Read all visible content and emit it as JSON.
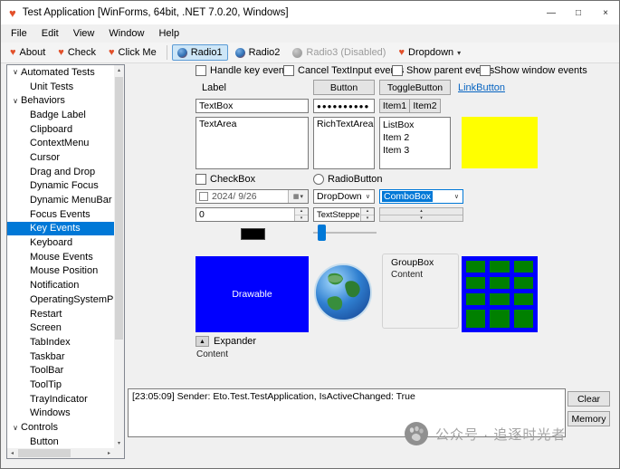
{
  "window": {
    "title": "Test Application [WinForms, 64bit, .NET 7.0.20, Windows]",
    "minimize": "—",
    "maximize": "□",
    "close": "×"
  },
  "menu": {
    "items": [
      "File",
      "Edit",
      "View",
      "Window",
      "Help"
    ]
  },
  "toolbar": {
    "about": "About",
    "check": "Check",
    "click_me": "Click Me",
    "radio1": "Radio1",
    "radio2": "Radio2",
    "radio3": "Radio3 (Disabled)",
    "dropdown": "Dropdown"
  },
  "icons": {
    "heart": "♥",
    "tree_expanded": "∨",
    "caret_up": "▴",
    "caret_down": "▾",
    "arrow_left": "◂",
    "arrow_right": "▸",
    "select_arrow": "∨",
    "calendar": "▦",
    "expander_collapse": "▲"
  },
  "sidebar": {
    "items": [
      {
        "label": "Automated Tests",
        "group": true
      },
      {
        "label": "Unit Tests"
      },
      {
        "label": "Behaviors",
        "group": true
      },
      {
        "label": "Badge Label"
      },
      {
        "label": "Clipboard"
      },
      {
        "label": "ContextMenu"
      },
      {
        "label": "Cursor"
      },
      {
        "label": "Drag and Drop"
      },
      {
        "label": "Dynamic Focus"
      },
      {
        "label": "Dynamic MenuBar"
      },
      {
        "label": "Focus Events"
      },
      {
        "label": "Key Events",
        "selected": true
      },
      {
        "label": "Keyboard"
      },
      {
        "label": "Mouse Events"
      },
      {
        "label": "Mouse Position"
      },
      {
        "label": "Notification"
      },
      {
        "label": "OperatingSystemPlatform"
      },
      {
        "label": "Restart"
      },
      {
        "label": "Screen"
      },
      {
        "label": "TabIndex"
      },
      {
        "label": "Taskbar"
      },
      {
        "label": "ToolBar"
      },
      {
        "label": "ToolTip"
      },
      {
        "label": "TrayIndicator"
      },
      {
        "label": "Windows"
      },
      {
        "label": "Controls",
        "group": true
      },
      {
        "label": "Button"
      }
    ]
  },
  "main": {
    "filters": {
      "handle_key": "Handle key events",
      "cancel_textinput": "Cancel TextInput events",
      "show_parent": "Show parent events",
      "show_window": "Show window events"
    },
    "label": "Label",
    "button": "Button",
    "toggle_button": "ToggleButton",
    "link_button": "LinkButton",
    "textbox": "TextBox",
    "password": "●●●●●●●●●●",
    "item1": "Item1",
    "item2": "Item2",
    "textarea": "TextArea",
    "richtextarea": "RichTextArea",
    "listbox": [
      "ListBox",
      "Item 2",
      "Item 3"
    ],
    "checkbox_label": "CheckBox",
    "radiobutton_label": "RadioButton",
    "date": "2024/ 9/26",
    "dropdown": "DropDown",
    "combobox": "ComboBox",
    "numeric": "0",
    "textstepper": "TextStepper",
    "drawable": "Drawable",
    "groupbox": {
      "title": "GroupBox",
      "content": "Content"
    },
    "expander": {
      "label": "Expander",
      "content": "Content"
    },
    "log": "[23:05:09] Sender: Eto.Test.TestApplication, IsActiveChanged: True",
    "clear": "Clear",
    "memory": "Memory"
  },
  "watermark": {
    "text": "公众号 · 追逐时光者"
  },
  "colors": {
    "accent": "#0078d7",
    "yellow": "#ffff00",
    "drawable_blue": "#0000ff",
    "table_blue": "#0000ff",
    "cell_green": "#008000",
    "link": "#0563c1",
    "heart": "#e2502a",
    "toolbar_checked_bg": "#cde6f7",
    "toolbar_checked_border": "#5b9bd5",
    "color_picker": "#000000"
  }
}
